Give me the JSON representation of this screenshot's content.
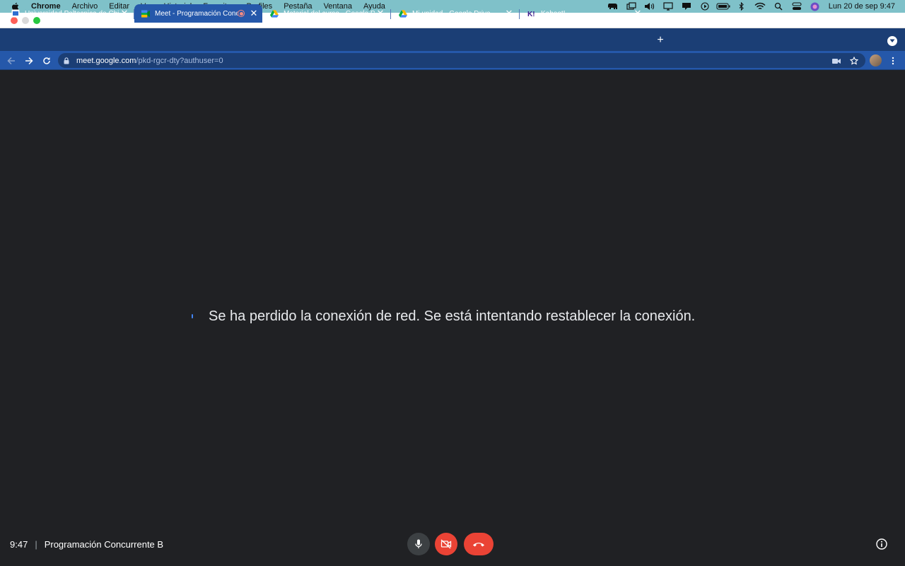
{
  "menubar": {
    "app_name": "Chrome",
    "items": [
      "Archivo",
      "Editar",
      "Ver",
      "Historial",
      "Favoritos",
      "Perfiles",
      "Pestaña",
      "Ventana",
      "Ayuda"
    ],
    "clock": "Lun 20 de sep  9:47"
  },
  "tabs": [
    {
      "title": "Universidad Poltecnica de Chiapas",
      "icon": "university-favicon",
      "active": false
    },
    {
      "title": "Meet - Programación Concurrente B",
      "icon": "meet-favicon",
      "active": true,
      "recording": true
    },
    {
      "title": "Material del curso - Google Drive",
      "icon": "drive-favicon",
      "active": false
    },
    {
      "title": "Mi unidad - Google Drive",
      "icon": "drive-favicon",
      "active": false
    },
    {
      "title": "Kahoot!",
      "icon": "kahoot-favicon",
      "active": false
    }
  ],
  "omnibox": {
    "host": "meet.google.com",
    "path": "/pkd-rgcr-dty?authuser=0"
  },
  "meet": {
    "reconnect_message": "Se ha perdido la conexión de red. Se está intentando restablecer la conexión.",
    "time": "9:47",
    "separator": "|",
    "meeting_name": "Programación Concurrente B"
  },
  "colors": {
    "tab_strip": "#1b3e75",
    "toolbar": "#2558aa",
    "meet_background": "#202124",
    "end_call": "#ea4335"
  }
}
